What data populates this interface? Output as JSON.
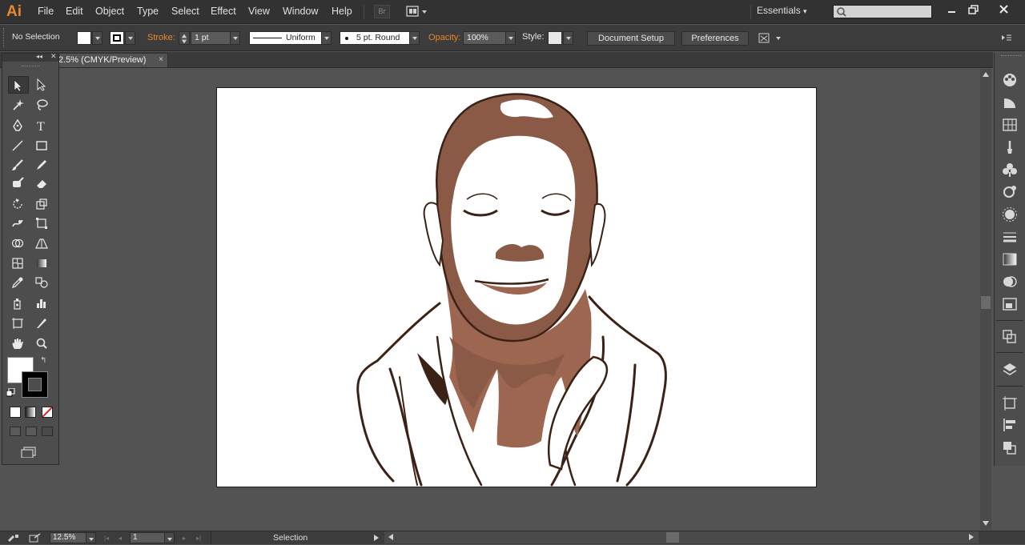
{
  "app": {
    "logo": "Ai",
    "workspace": "Essentials",
    "accent_color": "#e9872e"
  },
  "menu": [
    "File",
    "Edit",
    "Object",
    "Type",
    "Select",
    "Effect",
    "View",
    "Window",
    "Help"
  ],
  "menubar_buttons": {
    "bridge": "Br"
  },
  "control_bar": {
    "selection_status": "No Selection",
    "stroke_label": "Stroke:",
    "stroke_weight": "1 pt",
    "profile": "Uniform",
    "brush": "5 pt. Round",
    "opacity_label": "Opacity:",
    "opacity": "100%",
    "style_label": "Style:",
    "document_setup": "Document Setup",
    "preferences": "Preferences"
  },
  "document_tab": {
    "title": "2.5% (CMYK/Preview)",
    "close": "×"
  },
  "status_bar": {
    "zoom": "12.5%",
    "artboard": "1",
    "tool_name": "Selection"
  },
  "colors": {
    "fill": "#ffffff",
    "stroke": "#000000",
    "skin_dark": "#8a5a47",
    "skin_mid": "#9c6651",
    "outline": "#3b2216"
  },
  "tools": [
    "selection",
    "direct-selection",
    "magic-wand",
    "lasso",
    "pen",
    "type",
    "line",
    "rectangle",
    "paintbrush",
    "pencil",
    "blob-brush",
    "eraser",
    "rotate",
    "scale",
    "warp",
    "free-transform",
    "shape-builder",
    "perspective-grid",
    "mesh",
    "gradient",
    "eyedropper",
    "blend",
    "symbol-sprayer",
    "column-graph",
    "artboard",
    "slice",
    "hand",
    "zoom"
  ]
}
